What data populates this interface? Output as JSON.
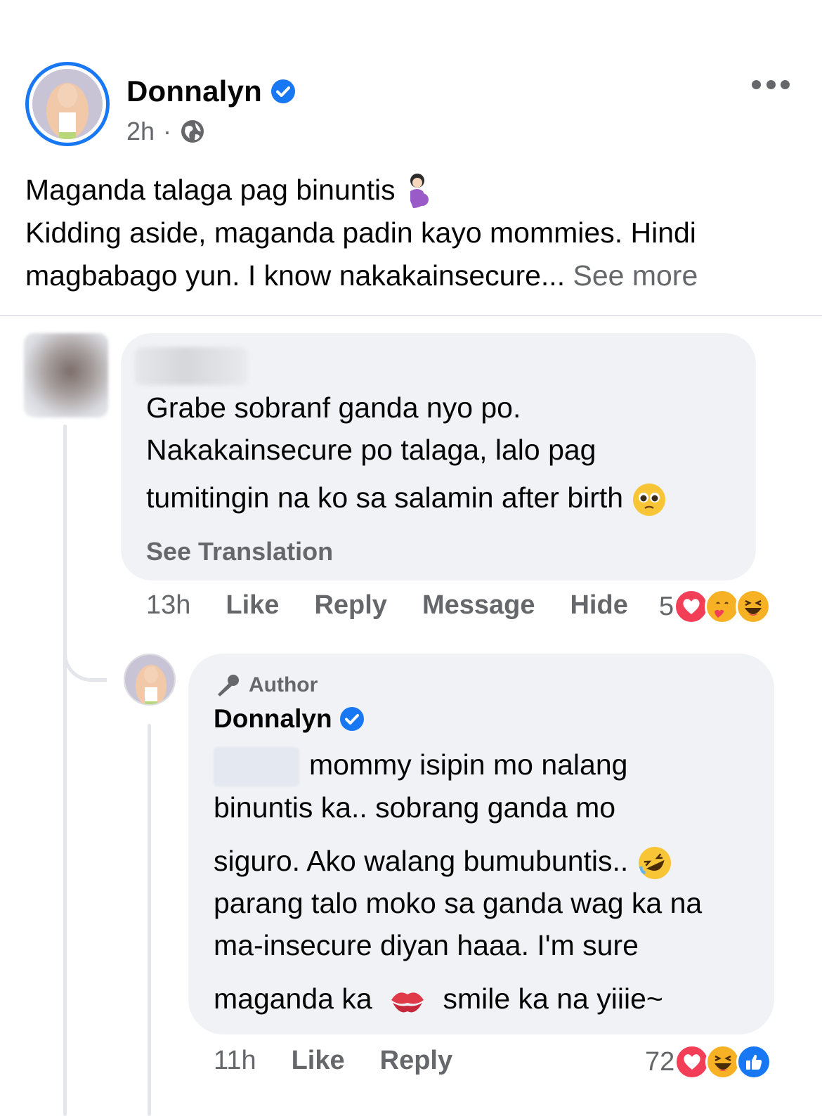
{
  "post": {
    "author_name": "Donnalyn",
    "time": "2h",
    "separator": "·",
    "text_line_1": "Maganda talaga pag binuntis",
    "text_line_2": "Kidding aside, maganda padin kayo mommies. Hindi",
    "text_line_3": "magbabago yun. I know nakakainsecure...",
    "see_more": "See more"
  },
  "comment": {
    "text_line_1": "Grabe sobranf ganda nyo po.",
    "text_line_2": "Nakakainsecure po talaga, lalo pag",
    "text_line_3": "tumitingin na ko sa salamin after birth",
    "see_translation": "See Translation",
    "time": "13h",
    "like": "Like",
    "reply": "Reply",
    "message": "Message",
    "hide": "Hide",
    "reaction_count": "5",
    "reactions": [
      "love-reaction",
      "care-reaction",
      "haha-reaction"
    ]
  },
  "reply": {
    "badge": "Author",
    "author_name": "Donnalyn",
    "text_line_1": "mommy isipin mo nalang",
    "text_line_2": "binuntis ka.. sobrang ganda mo",
    "text_line_3": "siguro. Ako walang bumubuntis..",
    "text_line_4": "parang talo moko sa ganda wag ka na",
    "text_line_5": "ma-insecure diyan haaa. I'm sure",
    "text_line_6a": "maganda ka",
    "text_line_6b": "smile ka na yiiie~",
    "time": "11h",
    "like": "Like",
    "reply": "Reply",
    "reaction_count": "72",
    "reactions": [
      "love-reaction",
      "haha-reaction",
      "like-reaction"
    ]
  },
  "colors": {
    "verified": "#1877f2",
    "secondary_text": "#65676b",
    "bubble": "#f0f2f5",
    "love": "#f33e58",
    "haha": "#f7b125",
    "like": "#1877f2"
  }
}
